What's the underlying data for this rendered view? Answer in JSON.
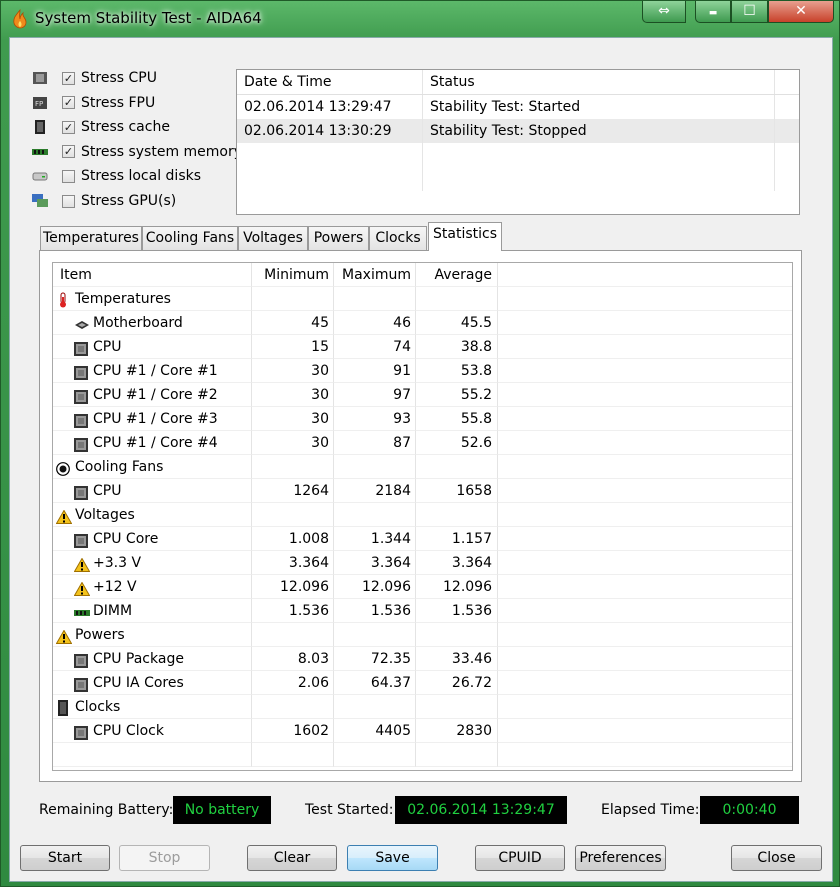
{
  "window": {
    "title": "System Stability Test - AIDA64"
  },
  "titlebar_buttons": {
    "swap": "⇔",
    "minimize": "▬",
    "maximize": "☐",
    "close": "✕"
  },
  "stress_options": [
    {
      "label": "Stress CPU",
      "checked": true,
      "icon": "cpu-icon"
    },
    {
      "label": "Stress FPU",
      "checked": true,
      "icon": "fpu-icon"
    },
    {
      "label": "Stress cache",
      "checked": true,
      "icon": "cache-icon"
    },
    {
      "label": "Stress system memory",
      "checked": true,
      "icon": "memory-icon"
    },
    {
      "label": "Stress local disks",
      "checked": false,
      "icon": "disk-icon"
    },
    {
      "label": "Stress GPU(s)",
      "checked": false,
      "icon": "gpu-icon"
    }
  ],
  "log": {
    "headers": [
      "Date & Time",
      "Status"
    ],
    "rows": [
      {
        "datetime": "02.06.2014 13:29:47",
        "status": "Stability Test: Started"
      },
      {
        "datetime": "02.06.2014 13:30:29",
        "status": "Stability Test: Stopped"
      }
    ]
  },
  "tabs": [
    "Temperatures",
    "Cooling Fans",
    "Voltages",
    "Powers",
    "Clocks",
    "Statistics"
  ],
  "active_tab": "Statistics",
  "stats": {
    "headers": [
      "Item",
      "Minimum",
      "Maximum",
      "Average"
    ],
    "rows": [
      {
        "type": "group",
        "label": "Temperatures",
        "icon": "thermometer-icon"
      },
      {
        "type": "item",
        "label": "Motherboard",
        "icon": "motherboard-icon",
        "min": "45",
        "max": "46",
        "avg": "45.5"
      },
      {
        "type": "item",
        "label": "CPU",
        "icon": "chip-icon",
        "min": "15",
        "max": "74",
        "avg": "38.8"
      },
      {
        "type": "item",
        "label": "CPU #1 / Core #1",
        "icon": "chip-icon",
        "min": "30",
        "max": "91",
        "avg": "53.8"
      },
      {
        "type": "item",
        "label": "CPU #1 / Core #2",
        "icon": "chip-icon",
        "min": "30",
        "max": "97",
        "avg": "55.2"
      },
      {
        "type": "item",
        "label": "CPU #1 / Core #3",
        "icon": "chip-icon",
        "min": "30",
        "max": "93",
        "avg": "55.8"
      },
      {
        "type": "item",
        "label": "CPU #1 / Core #4",
        "icon": "chip-icon",
        "min": "30",
        "max": "87",
        "avg": "52.6"
      },
      {
        "type": "group",
        "label": "Cooling Fans",
        "icon": "fan-icon"
      },
      {
        "type": "item",
        "label": "CPU",
        "icon": "chip-icon",
        "min": "1264",
        "max": "2184",
        "avg": "1658"
      },
      {
        "type": "group",
        "label": "Voltages",
        "icon": "warning-icon"
      },
      {
        "type": "item",
        "label": "CPU Core",
        "icon": "chip-icon",
        "min": "1.008",
        "max": "1.344",
        "avg": "1.157"
      },
      {
        "type": "item",
        "label": "+3.3 V",
        "icon": "warning-icon",
        "min": "3.364",
        "max": "3.364",
        "avg": "3.364"
      },
      {
        "type": "item",
        "label": "+12 V",
        "icon": "warning-icon",
        "min": "12.096",
        "max": "12.096",
        "avg": "12.096"
      },
      {
        "type": "item",
        "label": "DIMM",
        "icon": "memory-icon",
        "min": "1.536",
        "max": "1.536",
        "avg": "1.536"
      },
      {
        "type": "group",
        "label": "Powers",
        "icon": "warning-icon"
      },
      {
        "type": "item",
        "label": "CPU Package",
        "icon": "chip-icon",
        "min": "8.03",
        "max": "72.35",
        "avg": "33.46"
      },
      {
        "type": "item",
        "label": "CPU IA Cores",
        "icon": "chip-icon",
        "min": "2.06",
        "max": "64.37",
        "avg": "26.72"
      },
      {
        "type": "group",
        "label": "Clocks",
        "icon": "clock-chip-icon"
      },
      {
        "type": "item",
        "label": "CPU Clock",
        "icon": "chip-icon",
        "min": "1602",
        "max": "4405",
        "avg": "2830"
      },
      {
        "type": "empty"
      }
    ]
  },
  "status": {
    "battery_label": "Remaining Battery:",
    "battery_value": "No battery",
    "started_label": "Test Started:",
    "started_value": "02.06.2014 13:29:47",
    "elapsed_label": "Elapsed Time:",
    "elapsed_value": "0:00:40"
  },
  "buttons": {
    "start": "Start",
    "stop": "Stop",
    "clear": "Clear",
    "save": "Save",
    "cpuid": "CPUID",
    "preferences": "Preferences",
    "close": "Close"
  },
  "colors": {
    "lcd_text": "#20d040",
    "lcd_bg": "#000000",
    "window_frame": "#3f9b4e"
  }
}
